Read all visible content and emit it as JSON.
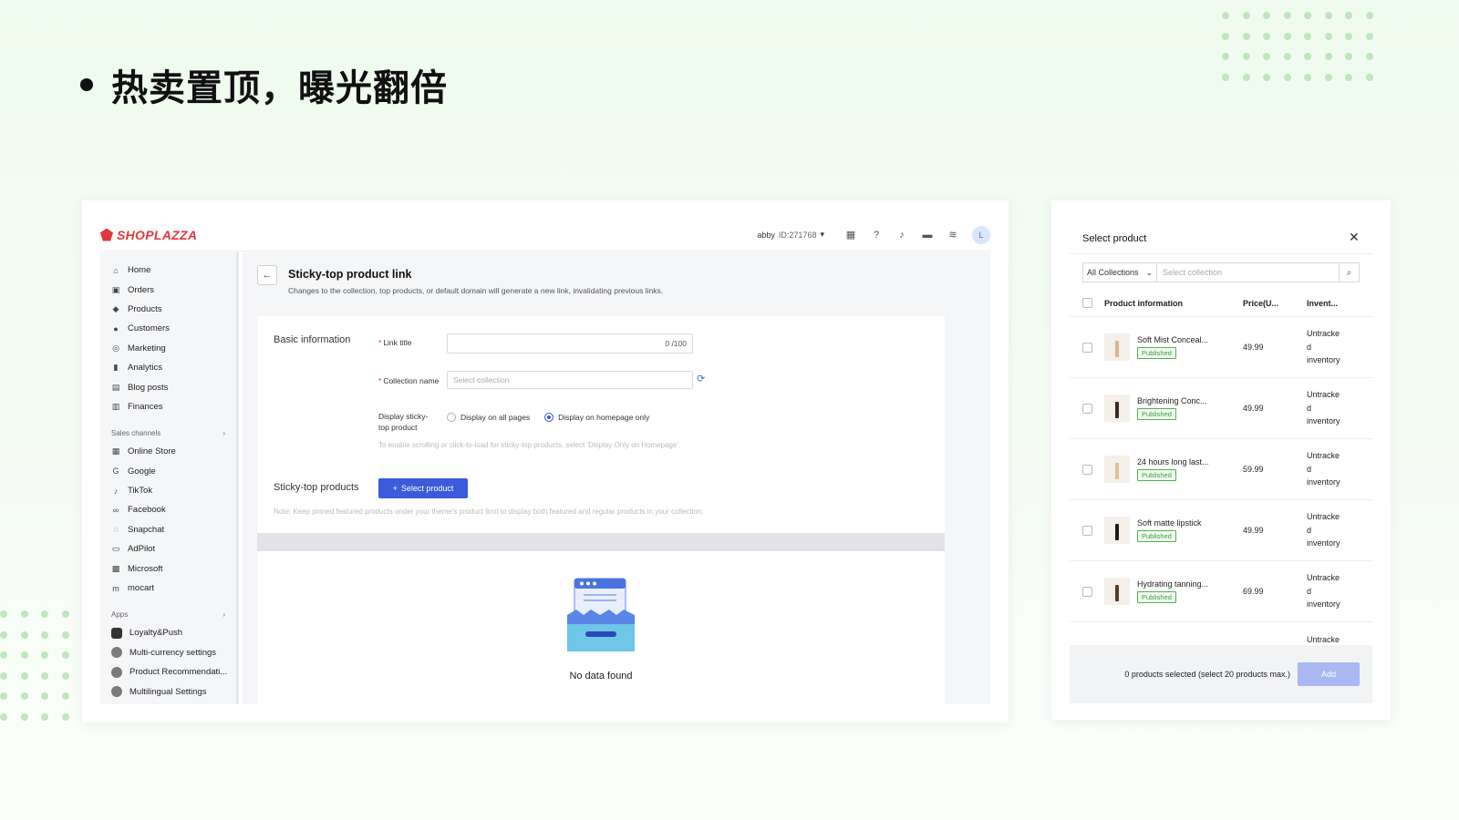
{
  "headline": "热卖置顶，曝光翻倍",
  "colors": {
    "accent": "#3b5bdb",
    "brand": "#e0383e",
    "published": "#52b152"
  },
  "topbar": {
    "brand": "SHOPLAZZA",
    "account_name": "abby",
    "account_id": "ID:271768",
    "avatar_initial": "L",
    "icons": [
      "store-icon",
      "help-icon",
      "bell-icon",
      "chat-icon",
      "wifi-icon"
    ]
  },
  "sidebar": {
    "items": [
      {
        "label": "Home",
        "icon": "home-icon"
      },
      {
        "label": "Orders",
        "icon": "orders-icon"
      },
      {
        "label": "Products",
        "icon": "tag-icon"
      },
      {
        "label": "Customers",
        "icon": "user-icon"
      },
      {
        "label": "Marketing",
        "icon": "marketing-icon"
      },
      {
        "label": "Analytics",
        "icon": "analytics-icon"
      },
      {
        "label": "Blog posts",
        "icon": "blog-icon"
      },
      {
        "label": "Finances",
        "icon": "finance-icon"
      }
    ],
    "sales_channels_title": "Sales channels",
    "sales_channels": [
      {
        "label": "Online Store",
        "icon": "store-icon"
      },
      {
        "label": "Google",
        "icon": "google-icon"
      },
      {
        "label": "TikTok",
        "icon": "tiktok-icon"
      },
      {
        "label": "Facebook",
        "icon": "facebook-icon"
      },
      {
        "label": "Snapchat",
        "icon": "snapchat-icon"
      },
      {
        "label": "AdPilot",
        "icon": "adpilot-icon"
      },
      {
        "label": "Microsoft",
        "icon": "microsoft-icon"
      },
      {
        "label": "mocart",
        "icon": "mocart-icon"
      }
    ],
    "apps_title": "Apps",
    "apps": [
      {
        "label": "Loyalty&Push",
        "icon": "loyalty-icon"
      },
      {
        "label": "Multi-currency settings",
        "icon": "currency-icon"
      },
      {
        "label": "Product Recommendati...",
        "icon": "recommend-icon"
      },
      {
        "label": "Multilingual Settings",
        "icon": "language-icon"
      }
    ]
  },
  "page": {
    "title": "Sticky-top product link",
    "subtitle": "Changes to the collection, top products, or default domain will generate a new link, invalidating previous links.",
    "basic_info_title": "Basic information",
    "link_title_label": "Link title",
    "link_title_counter": "0 /100",
    "collection_label": "Collection name",
    "collection_placeholder": "Select collection",
    "display_label": "Display sticky-top product",
    "radio_all": "Display on all pages",
    "radio_home": "Display on homepage only",
    "display_hint": "To enable scrolling or click-to-load for sticky-top products, select 'Display Only on Homepage'.",
    "sticky_title": "Sticky-top products",
    "select_product_btn": "Select product",
    "note": "Note: Keep pinned featured products under your theme's product limit to display both featured and regular products in your collection.",
    "empty_text": "No data found"
  },
  "modal": {
    "title": "Select product",
    "collection_select": "All Collections",
    "collection_placeholder": "Select collection",
    "headers": {
      "info": "Product information",
      "price": "Price(U...",
      "inventory": "Invent..."
    },
    "products": [
      {
        "name": "Soft Mist Conceal...",
        "status": "Published",
        "price": "49.99",
        "inventory": [
          "Untracke",
          "d",
          "inventory"
        ],
        "color": "#d9b48f"
      },
      {
        "name": "Brightening Conc...",
        "status": "Published",
        "price": "49.99",
        "inventory": [
          "Untracke",
          "d",
          "inventory"
        ],
        "color": "#3a2a22"
      },
      {
        "name": "24 hours long last...",
        "status": "Published",
        "price": "59.99",
        "inventory": [
          "Untracke",
          "d",
          "inventory"
        ],
        "color": "#e0bf95"
      },
      {
        "name": "Soft matte lipstick",
        "status": "Published",
        "price": "49.99",
        "inventory": [
          "Untracke",
          "d",
          "inventory"
        ],
        "color": "#1b1b1b"
      },
      {
        "name": "Hydrating tanning...",
        "status": "Published",
        "price": "69.99",
        "inventory": [
          "Untracke",
          "d",
          "inventory"
        ],
        "color": "#5a3a26"
      }
    ],
    "partial_row_inventory": "Untracke",
    "footer_text": "0 products selected (select 20 products max.)",
    "add_btn": "Add"
  }
}
